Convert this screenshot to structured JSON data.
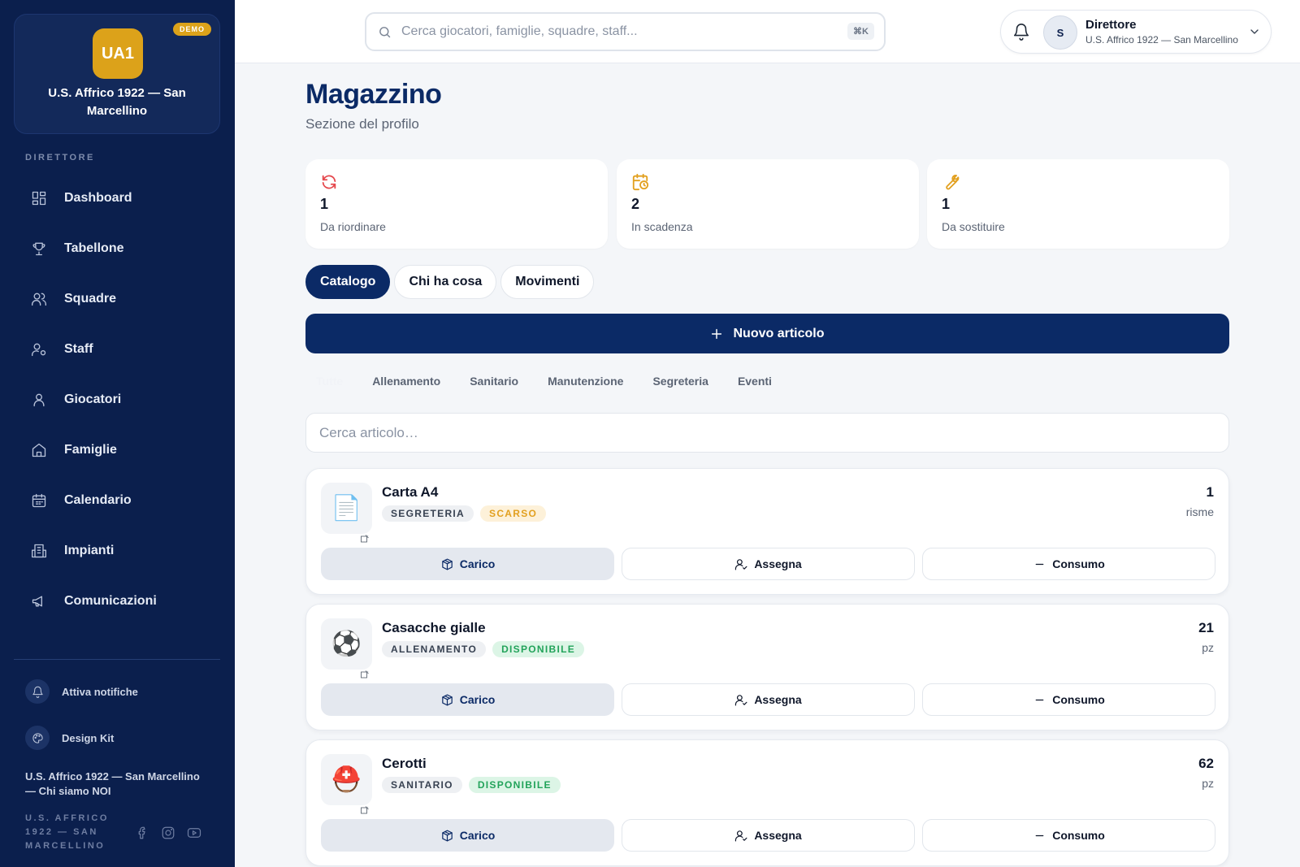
{
  "sidebar": {
    "club_initials": "UA1",
    "demo_badge": "DEMO",
    "club_name": "U.S. Affrico 1922 — San Marcellino",
    "role": "DIRETTORE",
    "items": [
      {
        "label": "Dashboard",
        "icon": "dashboard-icon"
      },
      {
        "label": "Tabellone",
        "icon": "trophy-icon"
      },
      {
        "label": "Squadre",
        "icon": "users-icon"
      },
      {
        "label": "Staff",
        "icon": "user-gear-icon"
      },
      {
        "label": "Giocatori",
        "icon": "user-icon"
      },
      {
        "label": "Famiglie",
        "icon": "home-icon"
      },
      {
        "label": "Calendario",
        "icon": "calendar-icon"
      },
      {
        "label": "Impianti",
        "icon": "building-icon"
      },
      {
        "label": "Comunicazioni",
        "icon": "megaphone-icon"
      }
    ],
    "notifications_label": "Attiva notifiche",
    "design_kit_label": "Design Kit",
    "footer_link": "U.S. Affrico 1922 — San Marcellino — Chi siamo NOI",
    "footer_small": "U.S. AFFRICO 1922 — SAN MARCELLINO"
  },
  "topbar": {
    "search_placeholder": "Cerca giocatori, famiglie, squadre, staff...",
    "shortcut": "⌘K",
    "user_initial": "S",
    "user_role": "Direttore",
    "user_club": "U.S. Affrico 1922 — San Marcellino"
  },
  "main": {
    "title": "Magazzino",
    "subtitle": "Sezione del profilo",
    "stats": [
      {
        "value": "1",
        "label": "Da riordinare",
        "icon": "refresh-icon",
        "color": "#e5484d"
      },
      {
        "value": "2",
        "label": "In scadenza",
        "icon": "calendar-clock-icon",
        "color": "#e2a01f"
      },
      {
        "value": "1",
        "label": "Da sostituire",
        "icon": "wrench-icon",
        "color": "#e2a01f"
      }
    ],
    "tabs": [
      "Catalogo",
      "Chi ha cosa",
      "Movimenti"
    ],
    "new_item_label": "Nuovo articolo",
    "categories": [
      "Tutte",
      "Allenamento",
      "Sanitario",
      "Manutenzione",
      "Segreteria",
      "Eventi"
    ],
    "article_search_placeholder": "Cerca articolo…",
    "actions": {
      "load": "Carico",
      "assign": "Assegna",
      "consume": "Consumo"
    },
    "items": [
      {
        "emoji": "📄",
        "name": "Carta A4",
        "category": "SEGRETERIA",
        "status": "SCARSO",
        "qty": "1",
        "unit": "risme"
      },
      {
        "emoji": "⚽",
        "name": "Casacche gialle",
        "category": "ALLENAMENTO",
        "status": "DISPONIBILE",
        "qty": "21",
        "unit": "pz"
      },
      {
        "emoji": "⛑️",
        "name": "Cerotti",
        "category": "SANITARIO",
        "status": "DISPONIBILE",
        "qty": "62",
        "unit": "pz"
      }
    ]
  }
}
